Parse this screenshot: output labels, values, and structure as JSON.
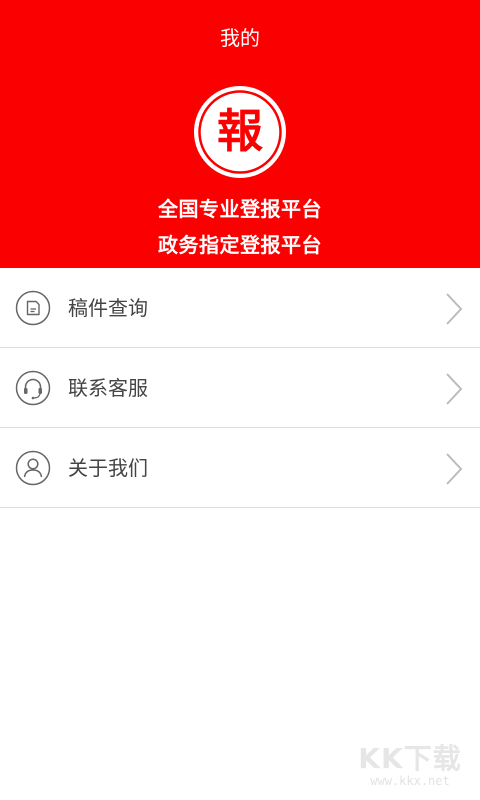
{
  "colors": {
    "brand": "#fb0000",
    "divider": "#dedede",
    "label": "#444444",
    "icon_stroke": "#666666",
    "chevron": "#bbbbbb"
  },
  "header": {
    "title": "我的",
    "logo_char": "報",
    "slogan_line1": "全国专业登报平台",
    "slogan_line2": "政务指定登报平台"
  },
  "menu": {
    "items": [
      {
        "label": "稿件查询",
        "icon": "document-icon"
      },
      {
        "label": "联系客服",
        "icon": "headset-icon"
      },
      {
        "label": "关于我们",
        "icon": "user-icon"
      }
    ]
  },
  "watermark": {
    "logo_text": "KK下载",
    "url": "www.kkx.net"
  }
}
